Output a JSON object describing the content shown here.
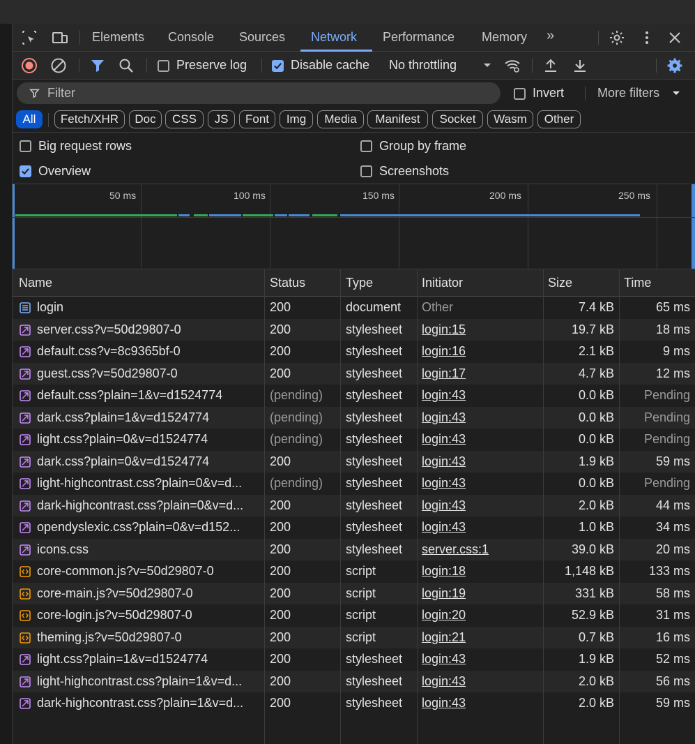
{
  "tabs": {
    "elements": "Elements",
    "console": "Console",
    "sources": "Sources",
    "network": "Network",
    "performance": "Performance",
    "memory": "Memory",
    "more": "»"
  },
  "toolbar": {
    "preserve_log": "Preserve log",
    "disable_cache": "Disable cache",
    "throttling": "No throttling"
  },
  "filter": {
    "placeholder": "Filter",
    "invert": "Invert",
    "more_filters": "More filters"
  },
  "chips": [
    "All",
    "Fetch/XHR",
    "Doc",
    "CSS",
    "JS",
    "Font",
    "Img",
    "Media",
    "Manifest",
    "Socket",
    "Wasm",
    "Other"
  ],
  "options": {
    "big_request_rows": "Big request rows",
    "overview": "Overview",
    "group_by_frame": "Group by frame",
    "screenshots": "Screenshots"
  },
  "overview": {
    "ticks": [
      "50 ms",
      "100 ms",
      "150 ms",
      "200 ms",
      "250 ms"
    ]
  },
  "table": {
    "headers": {
      "name": "Name",
      "status": "Status",
      "type": "Type",
      "initiator": "Initiator",
      "size": "Size",
      "time": "Time"
    },
    "rows": [
      {
        "name": "login",
        "kind": "doc",
        "status": "200",
        "type": "document",
        "initiator": "Other",
        "size": "7.4 kB",
        "time": "65 ms"
      },
      {
        "name": "server.css?v=50d29807-0",
        "kind": "css",
        "status": "200",
        "type": "stylesheet",
        "initiator": "login:15",
        "size": "19.7 kB",
        "time": "18 ms"
      },
      {
        "name": "default.css?v=8c9365bf-0",
        "kind": "css",
        "status": "200",
        "type": "stylesheet",
        "initiator": "login:16",
        "size": "2.1 kB",
        "time": "9 ms"
      },
      {
        "name": "guest.css?v=50d29807-0",
        "kind": "css",
        "status": "200",
        "type": "stylesheet",
        "initiator": "login:17",
        "size": "4.7 kB",
        "time": "12 ms"
      },
      {
        "name": "default.css?plain=1&v=d1524774",
        "kind": "css",
        "status": "(pending)",
        "type": "stylesheet",
        "initiator": "login:43",
        "size": "0.0 kB",
        "time": "Pending"
      },
      {
        "name": "dark.css?plain=1&v=d1524774",
        "kind": "css",
        "status": "(pending)",
        "type": "stylesheet",
        "initiator": "login:43",
        "size": "0.0 kB",
        "time": "Pending"
      },
      {
        "name": "light.css?plain=0&v=d1524774",
        "kind": "css",
        "status": "(pending)",
        "type": "stylesheet",
        "initiator": "login:43",
        "size": "0.0 kB",
        "time": "Pending"
      },
      {
        "name": "dark.css?plain=0&v=d1524774",
        "kind": "css",
        "status": "200",
        "type": "stylesheet",
        "initiator": "login:43",
        "size": "1.9 kB",
        "time": "59 ms"
      },
      {
        "name": "light-highcontrast.css?plain=0&v=d...",
        "kind": "css",
        "status": "(pending)",
        "type": "stylesheet",
        "initiator": "login:43",
        "size": "0.0 kB",
        "time": "Pending"
      },
      {
        "name": "dark-highcontrast.css?plain=0&v=d...",
        "kind": "css",
        "status": "200",
        "type": "stylesheet",
        "initiator": "login:43",
        "size": "2.0 kB",
        "time": "44 ms"
      },
      {
        "name": "opendyslexic.css?plain=0&v=d152...",
        "kind": "css",
        "status": "200",
        "type": "stylesheet",
        "initiator": "login:43",
        "size": "1.0 kB",
        "time": "34 ms"
      },
      {
        "name": "icons.css",
        "kind": "css",
        "status": "200",
        "type": "stylesheet",
        "initiator": "server.css:1",
        "size": "39.0 kB",
        "time": "20 ms"
      },
      {
        "name": "core-common.js?v=50d29807-0",
        "kind": "js",
        "status": "200",
        "type": "script",
        "initiator": "login:18",
        "size": "1,148 kB",
        "time": "133 ms"
      },
      {
        "name": "core-main.js?v=50d29807-0",
        "kind": "js",
        "status": "200",
        "type": "script",
        "initiator": "login:19",
        "size": "331 kB",
        "time": "58 ms"
      },
      {
        "name": "core-login.js?v=50d29807-0",
        "kind": "js",
        "status": "200",
        "type": "script",
        "initiator": "login:20",
        "size": "52.9 kB",
        "time": "31 ms"
      },
      {
        "name": "theming.js?v=50d29807-0",
        "kind": "js",
        "status": "200",
        "type": "script",
        "initiator": "login:21",
        "size": "0.7 kB",
        "time": "16 ms"
      },
      {
        "name": "light.css?plain=1&v=d1524774",
        "kind": "css",
        "status": "200",
        "type": "stylesheet",
        "initiator": "login:43",
        "size": "1.9 kB",
        "time": "52 ms"
      },
      {
        "name": "light-highcontrast.css?plain=1&v=d...",
        "kind": "css",
        "status": "200",
        "type": "stylesheet",
        "initiator": "login:43",
        "size": "2.0 kB",
        "time": "56 ms"
      },
      {
        "name": "dark-highcontrast.css?plain=1&v=d...",
        "kind": "css",
        "status": "200",
        "type": "stylesheet",
        "initiator": "login:43",
        "size": "2.0 kB",
        "time": "59 ms"
      }
    ]
  },
  "icons": {
    "inspect": "inspect-element-icon",
    "device": "device-toolbar-icon",
    "settings": "gear-icon",
    "kebab": "more-vert-icon",
    "close": "close-icon",
    "record": "stop-recording-icon",
    "clear": "clear-icon",
    "filter": "filter-icon",
    "search": "search-icon",
    "wifi": "network-conditions-icon",
    "upload": "import-har-icon",
    "download": "export-har-icon"
  },
  "colors": {
    "accent": "#7cacf8",
    "record": "#f28b82",
    "doc_icon": "#7cacf8",
    "css_icon": "#c58af9",
    "js_icon": "#f29900"
  }
}
